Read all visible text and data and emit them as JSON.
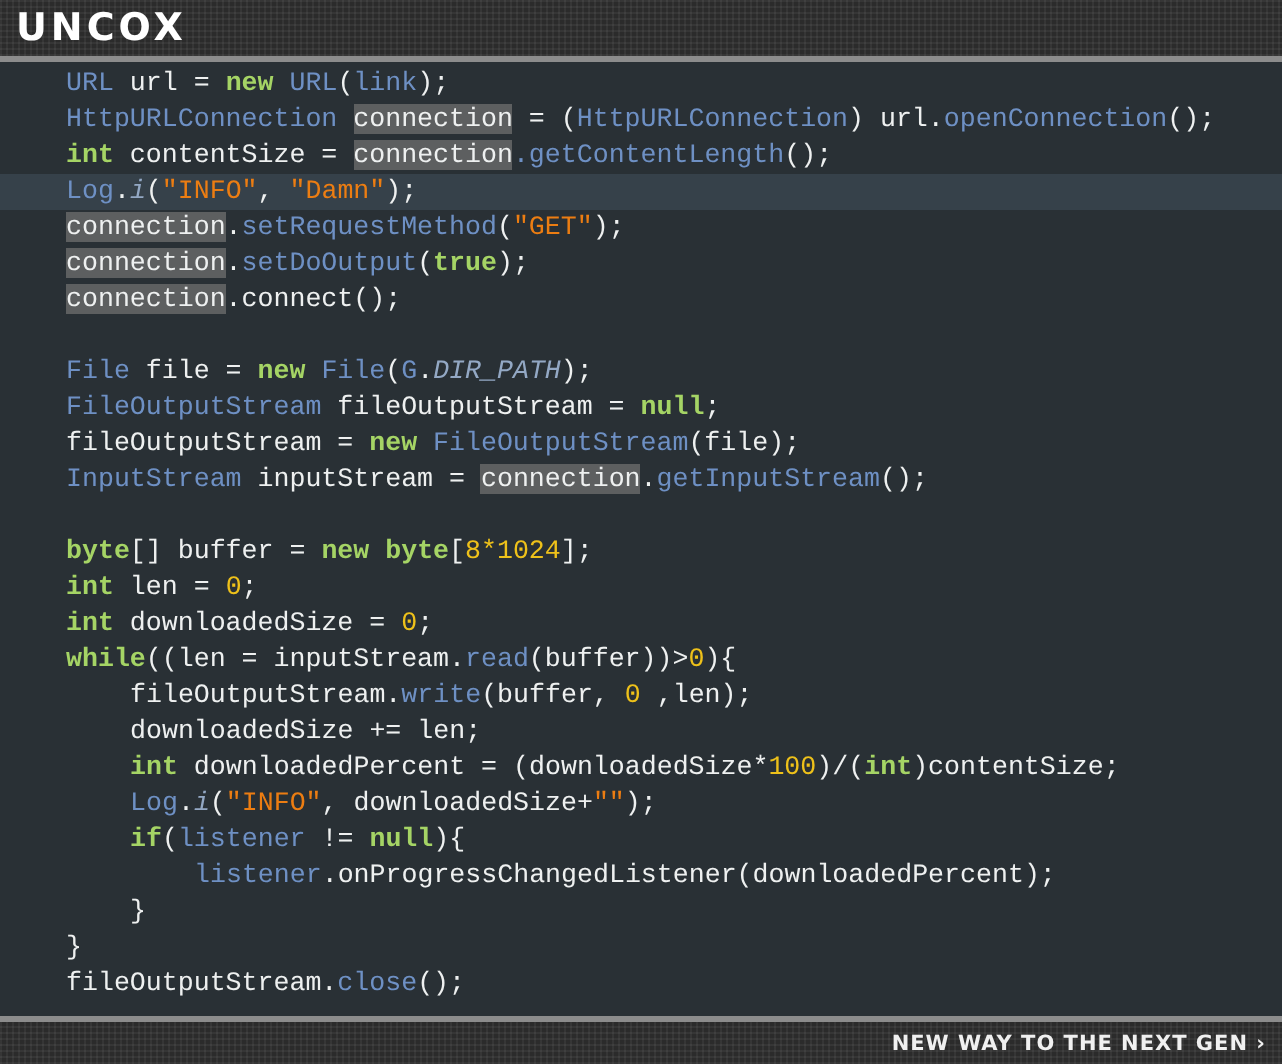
{
  "header": {
    "logo": "UNCOX"
  },
  "code": [
    {
      "kind": "code",
      "current": false,
      "tokens": [
        {
          "kind": "type",
          "text": "URL"
        },
        {
          "kind": "plain",
          "text": " url = "
        },
        {
          "kind": "keyword",
          "text": "new "
        },
        {
          "kind": "type",
          "text": "URL"
        },
        {
          "kind": "plain",
          "text": "("
        },
        {
          "kind": "type",
          "text": "link"
        },
        {
          "kind": "plain",
          "text": ");"
        }
      ]
    },
    {
      "kind": "code",
      "current": false,
      "tokens": [
        {
          "kind": "type",
          "text": "HttpURLConnection "
        },
        {
          "kind": "highlight",
          "text": "connection"
        },
        {
          "kind": "plain",
          "text": " = ("
        },
        {
          "kind": "type",
          "text": "HttpURLConnection"
        },
        {
          "kind": "plain",
          "text": ") url."
        },
        {
          "kind": "type",
          "text": "openConnection"
        },
        {
          "kind": "plain",
          "text": "();"
        }
      ]
    },
    {
      "kind": "code",
      "current": false,
      "tokens": [
        {
          "kind": "keyword",
          "text": "int"
        },
        {
          "kind": "plain",
          "text": " contentSize = "
        },
        {
          "kind": "highlight",
          "text": "connection"
        },
        {
          "kind": "type",
          "text": ".getContentLength"
        },
        {
          "kind": "plain",
          "text": "();"
        }
      ]
    },
    {
      "kind": "code",
      "current": true,
      "tokens": [
        {
          "kind": "type",
          "text": "Log"
        },
        {
          "kind": "plain",
          "text": "."
        },
        {
          "kind": "italic",
          "text": "i"
        },
        {
          "kind": "plain",
          "text": "("
        },
        {
          "kind": "string",
          "text": "\"INFO\""
        },
        {
          "kind": "plain",
          "text": ", "
        },
        {
          "kind": "string",
          "text": "\"Damn\""
        },
        {
          "kind": "plain",
          "text": ");"
        }
      ]
    },
    {
      "kind": "code",
      "current": false,
      "tokens": [
        {
          "kind": "highlight",
          "text": "connection"
        },
        {
          "kind": "plain",
          "text": "."
        },
        {
          "kind": "type",
          "text": "setRequestMethod"
        },
        {
          "kind": "plain",
          "text": "("
        },
        {
          "kind": "string",
          "text": "\"GET\""
        },
        {
          "kind": "plain",
          "text": ");"
        }
      ]
    },
    {
      "kind": "code",
      "current": false,
      "tokens": [
        {
          "kind": "highlight",
          "text": "connection"
        },
        {
          "kind": "plain",
          "text": "."
        },
        {
          "kind": "type",
          "text": "setDoOutput"
        },
        {
          "kind": "plain",
          "text": "("
        },
        {
          "kind": "keyword",
          "text": "true"
        },
        {
          "kind": "plain",
          "text": ");"
        }
      ]
    },
    {
      "kind": "code",
      "current": false,
      "tokens": [
        {
          "kind": "highlight",
          "text": "connection"
        },
        {
          "kind": "plain",
          "text": ".connect();"
        }
      ]
    },
    {
      "kind": "blank"
    },
    {
      "kind": "code",
      "current": false,
      "tokens": [
        {
          "kind": "type",
          "text": "File"
        },
        {
          "kind": "plain",
          "text": " file = "
        },
        {
          "kind": "keyword",
          "text": "new "
        },
        {
          "kind": "type",
          "text": "File"
        },
        {
          "kind": "plain",
          "text": "("
        },
        {
          "kind": "type",
          "text": "G"
        },
        {
          "kind": "plain",
          "text": "."
        },
        {
          "kind": "italic",
          "text": "DIR_PATH"
        },
        {
          "kind": "plain",
          "text": ");"
        }
      ]
    },
    {
      "kind": "code",
      "current": false,
      "tokens": [
        {
          "kind": "type",
          "text": "FileOutputStream"
        },
        {
          "kind": "plain",
          "text": " fileOutputStream = "
        },
        {
          "kind": "keyword",
          "text": "null"
        },
        {
          "kind": "plain",
          "text": ";"
        }
      ]
    },
    {
      "kind": "code",
      "current": false,
      "tokens": [
        {
          "kind": "plain",
          "text": "fileOutputStream = "
        },
        {
          "kind": "keyword",
          "text": "new "
        },
        {
          "kind": "type",
          "text": "FileOutputStream"
        },
        {
          "kind": "plain",
          "text": "(file);"
        }
      ]
    },
    {
      "kind": "code",
      "current": false,
      "tokens": [
        {
          "kind": "type",
          "text": "InputStream"
        },
        {
          "kind": "plain",
          "text": " inputStream = "
        },
        {
          "kind": "highlight",
          "text": "connection"
        },
        {
          "kind": "plain",
          "text": "."
        },
        {
          "kind": "type",
          "text": "getInputStream"
        },
        {
          "kind": "plain",
          "text": "();"
        }
      ]
    },
    {
      "kind": "blank"
    },
    {
      "kind": "code",
      "current": false,
      "tokens": [
        {
          "kind": "keyword",
          "text": "byte"
        },
        {
          "kind": "plain",
          "text": "[] buffer = "
        },
        {
          "kind": "keyword",
          "text": "new "
        },
        {
          "kind": "keyword",
          "text": "byte"
        },
        {
          "kind": "plain",
          "text": "["
        },
        {
          "kind": "number",
          "text": "8*1024"
        },
        {
          "kind": "plain",
          "text": "];"
        }
      ]
    },
    {
      "kind": "code",
      "current": false,
      "tokens": [
        {
          "kind": "keyword",
          "text": "int"
        },
        {
          "kind": "plain",
          "text": " len = "
        },
        {
          "kind": "number",
          "text": "0"
        },
        {
          "kind": "plain",
          "text": ";"
        }
      ]
    },
    {
      "kind": "code",
      "current": false,
      "tokens": [
        {
          "kind": "keyword",
          "text": "int"
        },
        {
          "kind": "plain",
          "text": " downloadedSize = "
        },
        {
          "kind": "number",
          "text": "0"
        },
        {
          "kind": "plain",
          "text": ";"
        }
      ]
    },
    {
      "kind": "code",
      "current": false,
      "tokens": [
        {
          "kind": "keyword",
          "text": "while"
        },
        {
          "kind": "plain",
          "text": "((len = inputStream."
        },
        {
          "kind": "type",
          "text": "read"
        },
        {
          "kind": "plain",
          "text": "(buffer))>"
        },
        {
          "kind": "number",
          "text": "0"
        },
        {
          "kind": "plain",
          "text": "){"
        }
      ],
      "children": [
        {
          "kind": "code",
          "current": false,
          "tokens": [
            {
              "kind": "plain",
              "text": "fileOutputStream."
            },
            {
              "kind": "type",
              "text": "write"
            },
            {
              "kind": "plain",
              "text": "(buffer, "
            },
            {
              "kind": "number",
              "text": "0"
            },
            {
              "kind": "plain",
              "text": " ,len);"
            }
          ]
        },
        {
          "kind": "code",
          "current": false,
          "tokens": [
            {
              "kind": "plain",
              "text": "downloadedSize += len;"
            }
          ]
        },
        {
          "kind": "code",
          "current": false,
          "tokens": [
            {
              "kind": "keyword",
              "text": "int"
            },
            {
              "kind": "plain",
              "text": " downloadedPercent = (downloadedSize*"
            },
            {
              "kind": "number",
              "text": "100"
            },
            {
              "kind": "plain",
              "text": ")/("
            },
            {
              "kind": "keyword",
              "text": "int"
            },
            {
              "kind": "plain",
              "text": ")contentSize;"
            }
          ]
        },
        {
          "kind": "code",
          "current": false,
          "tokens": [
            {
              "kind": "type",
              "text": "Log"
            },
            {
              "kind": "plain",
              "text": "."
            },
            {
              "kind": "italic",
              "text": "i"
            },
            {
              "kind": "plain",
              "text": "("
            },
            {
              "kind": "string",
              "text": "\"INFO\""
            },
            {
              "kind": "plain",
              "text": ", downloadedSize+"
            },
            {
              "kind": "string",
              "text": "\"\""
            },
            {
              "kind": "plain",
              "text": ");"
            }
          ]
        },
        {
          "kind": "code",
          "current": false,
          "tokens": [
            {
              "kind": "keyword",
              "text": "if"
            },
            {
              "kind": "plain",
              "text": "("
            },
            {
              "kind": "type",
              "text": "listener"
            },
            {
              "kind": "plain",
              "text": " != "
            },
            {
              "kind": "keyword",
              "text": "null"
            },
            {
              "kind": "plain",
              "text": "){"
            }
          ],
          "children": [
            {
              "kind": "code",
              "current": false,
              "tokens": [
                {
                  "kind": "type",
                  "text": "listener"
                },
                {
                  "kind": "plain",
                  "text": ".onProgressChangedListener(downloadedPercent);"
                }
              ]
            }
          ]
        },
        {
          "kind": "code",
          "current": false,
          "tokens": [
            {
              "kind": "plain",
              "text": "}"
            }
          ]
        }
      ]
    },
    {
      "kind": "code",
      "current": false,
      "tokens": [
        {
          "kind": "plain",
          "text": "}"
        }
      ]
    },
    {
      "kind": "code",
      "current": false,
      "tokens": [
        {
          "kind": "plain",
          "text": "fileOutputStream."
        },
        {
          "kind": "type",
          "text": "close"
        },
        {
          "kind": "plain",
          "text": "();"
        }
      ]
    }
  ],
  "footer": {
    "tagline": "NEW WAY TO THE NEXT GEN ›"
  }
}
